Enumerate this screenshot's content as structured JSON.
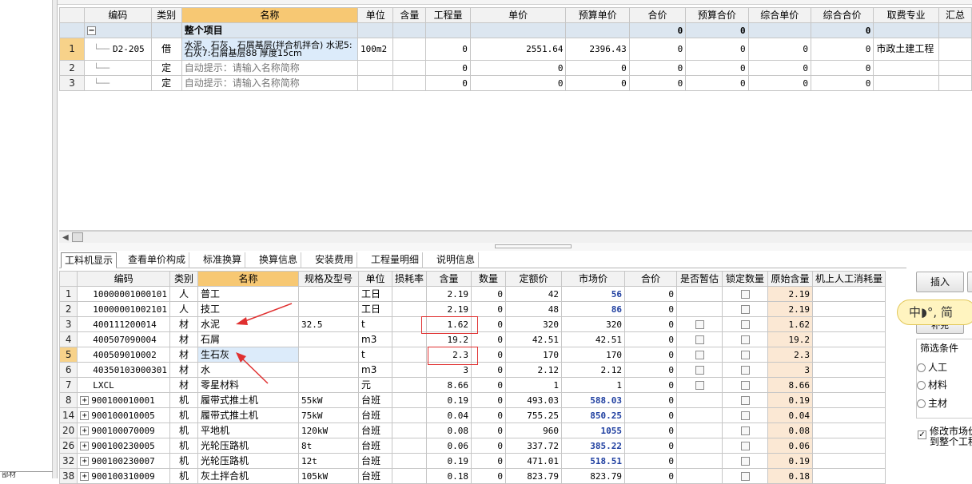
{
  "left_pane": {
    "bottom_text": "部材"
  },
  "top_table": {
    "headers": [
      "",
      "编码",
      "类别",
      "名称",
      "单位",
      "含量",
      "工程量",
      "单价",
      "预算单价",
      "合价",
      "预算合价",
      "综合单价",
      "综合合价",
      "取费专业",
      "汇总"
    ],
    "group_row": {
      "collapse": "−",
      "name": "整个项目",
      "hejia": "0",
      "yusuan_hejia": "0",
      "zonghe_hejia": "0"
    },
    "rows": [
      {
        "rn": "1",
        "code": "D2-205",
        "type": "借",
        "name": "水泥、石灰、石屑基层(拌合机拌合) 水泥5:石灰7:石屑基层88 厚度15cm",
        "unit": "100m2",
        "hanliang": "",
        "gongchengliang": "0",
        "danjia": "2551.64",
        "yusuan_danjia": "2396.43",
        "hejia": "0",
        "yusuan_hejia": "0",
        "zonghe_danjia": "0",
        "zonghe_hejia": "0",
        "qufei": "市政土建工程"
      },
      {
        "rn": "2",
        "code": "",
        "type": "定",
        "name": "自动提示：请输入名称简称",
        "unit": "",
        "hanliang": "",
        "gongchengliang": "0",
        "danjia": "0",
        "yusuan_danjia": "0",
        "hejia": "0",
        "yusuan_hejia": "0",
        "zonghe_danjia": "0",
        "zonghe_hejia": "0",
        "qufei": ""
      },
      {
        "rn": "3",
        "code": "",
        "type": "定",
        "name": "自动提示：请输入名称简称",
        "unit": "",
        "hanliang": "",
        "gongchengliang": "0",
        "danjia": "0",
        "yusuan_danjia": "0",
        "hejia": "0",
        "yusuan_hejia": "0",
        "zonghe_danjia": "0",
        "zonghe_hejia": "0",
        "qufei": ""
      }
    ]
  },
  "tabs": [
    "工料机显示",
    "查看单价构成",
    "标准换算",
    "换算信息",
    "安装费用",
    "工程量明细",
    "说明信息"
  ],
  "bottom_table": {
    "headers": [
      "",
      "编码",
      "类别",
      "名称",
      "规格及型号",
      "单位",
      "损耗率",
      "含量",
      "数量",
      "定额价",
      "市场价",
      "合价",
      "是否暂估",
      "锁定数量",
      "原始含量",
      "机上人工消耗量"
    ],
    "rows": [
      {
        "rn": "1",
        "expand": false,
        "code": "10000001000101",
        "type": "人",
        "name": "普工",
        "spec": "",
        "unit": "工日",
        "loss": "",
        "hanliang": "2.19",
        "qty": "0",
        "dinge": "42",
        "market": "56",
        "market_blue": true,
        "hejia": "0",
        "zangu": false,
        "lock": true,
        "orig": "2.19"
      },
      {
        "rn": "2",
        "expand": false,
        "code": "10000001002101",
        "type": "人",
        "name": "技工",
        "spec": "",
        "unit": "工日",
        "loss": "",
        "hanliang": "2.19",
        "qty": "0",
        "dinge": "48",
        "market": "86",
        "market_blue": true,
        "hejia": "0",
        "zangu": false,
        "lock": true,
        "orig": "2.19"
      },
      {
        "rn": "3",
        "expand": false,
        "code": "400111200014",
        "type": "材",
        "name": "水泥",
        "spec": "32.5",
        "unit": "t",
        "loss": "",
        "hanliang": "1.62",
        "qty": "0",
        "dinge": "320",
        "market": "320",
        "market_blue": false,
        "hejia": "0",
        "zangu": true,
        "lock": true,
        "orig": "1.62"
      },
      {
        "rn": "4",
        "expand": false,
        "code": "400507090004",
        "type": "材",
        "name": "石屑",
        "spec": "",
        "unit": "m3",
        "loss": "",
        "hanliang": "19.2",
        "qty": "0",
        "dinge": "42.51",
        "market": "42.51",
        "market_blue": false,
        "hejia": "0",
        "zangu": true,
        "lock": true,
        "orig": "19.2"
      },
      {
        "rn": "5",
        "expand": false,
        "code": "400509010002",
        "type": "材",
        "name": "生石灰",
        "spec": "",
        "unit": "t",
        "loss": "",
        "hanliang": "2.3",
        "qty": "0",
        "dinge": "170",
        "market": "170",
        "market_blue": false,
        "hejia": "0",
        "zangu": true,
        "lock": true,
        "orig": "2.3"
      },
      {
        "rn": "6",
        "expand": false,
        "code": "40350103000301",
        "type": "材",
        "name": "水",
        "spec": "",
        "unit": "m3",
        "loss": "",
        "hanliang": "3",
        "qty": "0",
        "dinge": "2.12",
        "market": "2.12",
        "market_blue": false,
        "hejia": "0",
        "zangu": true,
        "lock": true,
        "orig": "3"
      },
      {
        "rn": "7",
        "expand": false,
        "code": "LXCL",
        "type": "材",
        "name": "零星材料",
        "spec": "",
        "unit": "元",
        "loss": "",
        "hanliang": "8.66",
        "qty": "0",
        "dinge": "1",
        "market": "1",
        "market_blue": false,
        "hejia": "0",
        "zangu": true,
        "lock": true,
        "orig": "8.66"
      },
      {
        "rn": "8",
        "expand": true,
        "code": "900100010001",
        "type": "机",
        "name": "履带式推土机",
        "spec": "55kW",
        "unit": "台班",
        "loss": "",
        "hanliang": "0.19",
        "qty": "0",
        "dinge": "493.03",
        "market": "588.03",
        "market_blue": true,
        "hejia": "0",
        "zangu": false,
        "lock": true,
        "orig": "0.19"
      },
      {
        "rn": "14",
        "expand": true,
        "code": "900100010005",
        "type": "机",
        "name": "履带式推土机",
        "spec": "75kW",
        "unit": "台班",
        "loss": "",
        "hanliang": "0.04",
        "qty": "0",
        "dinge": "755.25",
        "market": "850.25",
        "market_blue": true,
        "hejia": "0",
        "zangu": false,
        "lock": true,
        "orig": "0.04"
      },
      {
        "rn": "20",
        "expand": true,
        "code": "900100070009",
        "type": "机",
        "name": "平地机",
        "spec": "120kW",
        "unit": "台班",
        "loss": "",
        "hanliang": "0.08",
        "qty": "0",
        "dinge": "960",
        "market": "1055",
        "market_blue": true,
        "hejia": "0",
        "zangu": false,
        "lock": true,
        "orig": "0.08"
      },
      {
        "rn": "26",
        "expand": true,
        "code": "900100230005",
        "type": "机",
        "name": "光轮压路机",
        "spec": "8t",
        "unit": "台班",
        "loss": "",
        "hanliang": "0.06",
        "qty": "0",
        "dinge": "337.72",
        "market": "385.22",
        "market_blue": true,
        "hejia": "0",
        "zangu": false,
        "lock": true,
        "orig": "0.06"
      },
      {
        "rn": "32",
        "expand": true,
        "code": "900100230007",
        "type": "机",
        "name": "光轮压路机",
        "spec": "12t",
        "unit": "台班",
        "loss": "",
        "hanliang": "0.19",
        "qty": "0",
        "dinge": "471.01",
        "market": "518.51",
        "market_blue": true,
        "hejia": "0",
        "zangu": false,
        "lock": true,
        "orig": "0.19"
      },
      {
        "rn": "38",
        "expand": true,
        "code": "900100310009",
        "type": "机",
        "name": "灰土拌合机",
        "spec": "105kW",
        "unit": "台班",
        "loss": "",
        "hanliang": "0.18",
        "qty": "0",
        "dinge": "823.79",
        "market": "823.79",
        "market_blue": false,
        "hejia": "0",
        "zangu": false,
        "lock": true,
        "orig": "0.18"
      }
    ]
  },
  "right_panel": {
    "insert_label": "插入",
    "supplement_label": "补充",
    "ime_text": "中◗°, 简",
    "filter_title": "筛选条件",
    "radios": [
      "人工",
      "材料",
      "主材"
    ],
    "modify_checkbox_label": "修改市场价到整个工程"
  },
  "colors": {
    "header_highlight": "#f7c873",
    "market_blue": "#1f3fa0",
    "annotation_red": "#e03030",
    "ime_bg": "#fff4c0"
  }
}
